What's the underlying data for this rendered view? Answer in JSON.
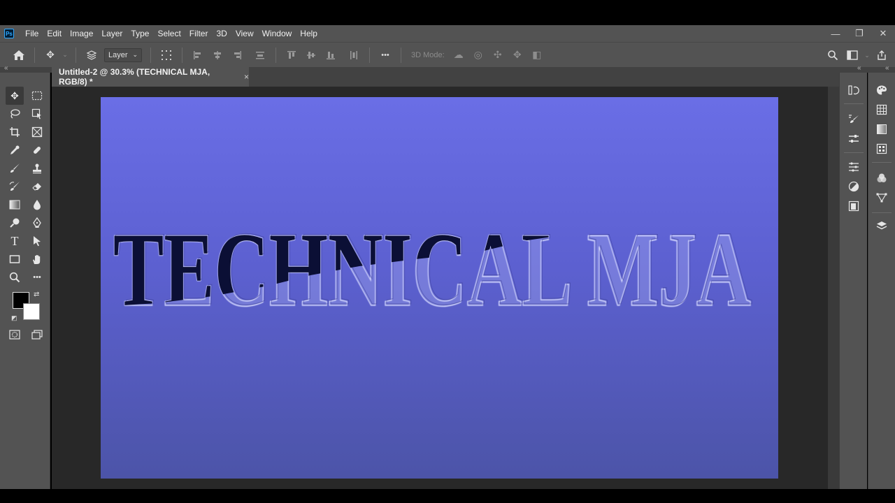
{
  "app": {
    "logo_text": "Ps"
  },
  "menu": {
    "items": [
      "File",
      "Edit",
      "Image",
      "Layer",
      "Type",
      "Select",
      "Filter",
      "3D",
      "View",
      "Window",
      "Help"
    ]
  },
  "window_controls": {
    "minimize": "—",
    "restore": "❐",
    "close": "✕"
  },
  "options": {
    "auto_select_value": "Layer",
    "three_d_mode_label": "3D Mode:",
    "more_label": "•••"
  },
  "document": {
    "tab_title": "Untitled-2 @ 30.3% (TECHNICAL MJA, RGB/8) *",
    "tab_close": "×"
  },
  "canvas": {
    "text": "TECHNICAL MJA",
    "colors": {
      "gradient_top": "#6a6ee6",
      "gradient_bottom": "#4c54a8",
      "text_fill": "#0b0f35"
    }
  },
  "colors": {
    "foreground": "#000000",
    "background": "#ffffff",
    "panel": "#535353",
    "workspace": "#282828"
  },
  "tools": [
    [
      "move-tool",
      "marquee-tool"
    ],
    [
      "lasso-tool",
      "object-select-tool"
    ],
    [
      "crop-tool",
      "frame-tool"
    ],
    [
      "eyedropper-tool",
      "healing-brush-tool"
    ],
    [
      "brush-tool",
      "clone-stamp-tool"
    ],
    [
      "history-brush-tool",
      "eraser-tool"
    ],
    [
      "gradient-tool",
      "blur-tool"
    ],
    [
      "dodge-tool",
      "pen-tool"
    ],
    [
      "type-tool",
      "path-selection-tool"
    ],
    [
      "rectangle-tool",
      "hand-tool"
    ],
    [
      "zoom-tool",
      "more-tools"
    ]
  ]
}
